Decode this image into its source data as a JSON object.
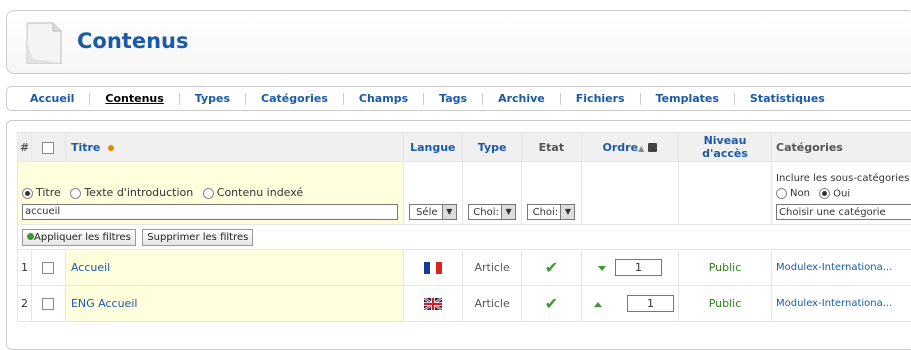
{
  "header": {
    "title": "Contenus",
    "icon": "document-icon"
  },
  "menu": [
    {
      "label": "Accueil",
      "active": false
    },
    {
      "label": "Contenus",
      "active": true
    },
    {
      "label": "Types",
      "active": false
    },
    {
      "label": "Catégories",
      "active": false
    },
    {
      "label": "Champs",
      "active": false
    },
    {
      "label": "Tags",
      "active": false
    },
    {
      "label": "Archive",
      "active": false
    },
    {
      "label": "Fichiers",
      "active": false
    },
    {
      "label": "Templates",
      "active": false
    },
    {
      "label": "Statistiques",
      "active": false
    }
  ],
  "table": {
    "columns": {
      "num": "#",
      "title": "Titre",
      "langue": "Langue",
      "type": "Type",
      "etat": "Etat",
      "ordre": "Ordre",
      "niveau": "Niveau d'accès",
      "categories": "Catégories"
    },
    "filters": {
      "search_scope_title": "Titre",
      "search_scope_intro": "Texte d'introduction",
      "search_scope_indexed": "Contenu indexé",
      "search_value": "accueil",
      "langue_select": "Séle",
      "type_select": "Choi:",
      "etat_select": "Choi:",
      "include_sub_label": "Inclure les sous-catégories",
      "include_no": "Non",
      "include_yes": "Oui",
      "category_select": "Choisir une catégorie",
      "apply_button": "Appliquer les filtres",
      "clear_button": "Supprimer les filtres"
    },
    "rows": [
      {
        "num": "1",
        "title": "Accueil",
        "lang": "fr",
        "type": "Article",
        "order": "1",
        "access": "Public",
        "category": "Modulex-Internationa..."
      },
      {
        "num": "2",
        "title": "ENG Accueil",
        "lang": "en",
        "type": "Article",
        "order": "1",
        "access": "Public",
        "category": "Modulex-Internationa..."
      }
    ]
  }
}
